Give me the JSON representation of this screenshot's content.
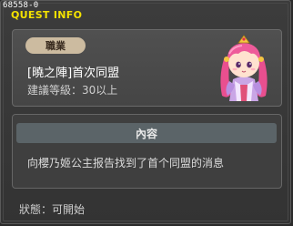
{
  "window": {
    "quest_id": "68558-0",
    "title": "QUEST INFO"
  },
  "quest": {
    "job_label": "職業",
    "name": "[曉之陣]首次同盟",
    "level_requirement": "建議等級：30以上"
  },
  "npc": {
    "icon": "pink-haired-princess-npc-sprite"
  },
  "content": {
    "header": "內容",
    "text": "向櫻乃姬公主报告找到了首个同盟的消息"
  },
  "status": {
    "text": "狀態：可開始"
  },
  "colors": {
    "title": "#f4e200",
    "badge_bg": "#ccbba0",
    "content_header_bg": "#5b6468"
  }
}
